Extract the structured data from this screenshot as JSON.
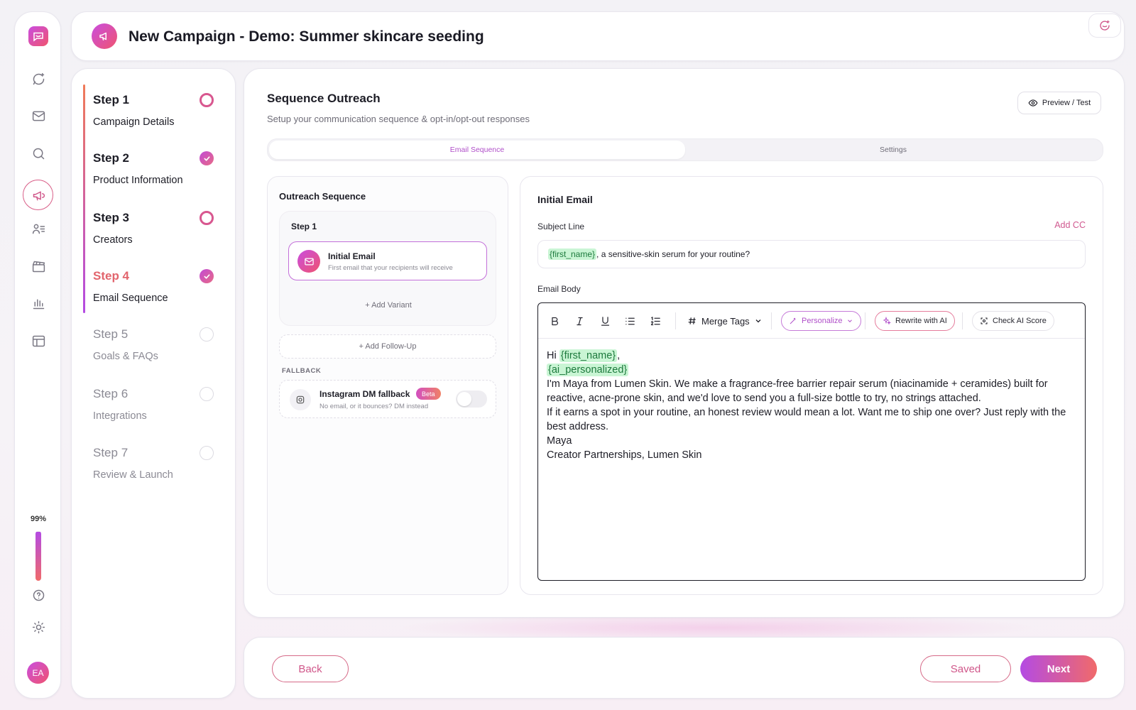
{
  "header": {
    "title": "New Campaign - Demo: Summer skincare seeding"
  },
  "sidebar": {
    "progress_label": "99%",
    "progress_value": 99,
    "avatar_initials": "EA",
    "icons": [
      "chat-sparkle-icon",
      "mail-icon",
      "search-icon",
      "megaphone-icon",
      "users-list-icon",
      "clapper-icon",
      "bar-chart-icon",
      "table-icon",
      "help-icon",
      "sun-icon"
    ]
  },
  "steps": [
    {
      "title": "Step 1",
      "subtitle": "Campaign Details",
      "status": "in-progress"
    },
    {
      "title": "Step 2",
      "subtitle": "Product Information",
      "status": "complete"
    },
    {
      "title": "Step 3",
      "subtitle": "Creators",
      "status": "in-progress"
    },
    {
      "title": "Step 4",
      "subtitle": "Email Sequence",
      "status": "complete-current"
    },
    {
      "title": "Step 5",
      "subtitle": "Goals & FAQs",
      "status": "pending"
    },
    {
      "title": "Step 6",
      "subtitle": "Integrations",
      "status": "pending"
    },
    {
      "title": "Step 7",
      "subtitle": "Review & Launch",
      "status": "pending"
    }
  ],
  "main": {
    "title": "Sequence Outreach",
    "subtitle": "Setup your communication sequence & opt-in/opt-out responses",
    "preview_label": "Preview / Test",
    "tabs": [
      {
        "label": "Email Sequence"
      },
      {
        "label": "Settings"
      }
    ]
  },
  "outreach": {
    "title": "Outreach Sequence",
    "step_label": "Step 1",
    "initial_title": "Initial Email",
    "initial_sub": "First email that your recipients will receive",
    "add_variant": "+ Add Variant",
    "add_followup": "+ Add Follow-Up",
    "fallback_heading": "FALLBACK",
    "fallback_title": "Instagram DM fallback",
    "fallback_badge": "Beta",
    "fallback_sub": "No email, or it bounces? DM instead"
  },
  "editor": {
    "title": "Initial Email",
    "subject_label": "Subject Line",
    "add_cc": "Add CC",
    "subject_tag": "{first_name}",
    "subject_rest": ", a sensitive-skin serum for your routine?",
    "body_label": "Email Body",
    "toolbar": {
      "merge_tags": "Merge Tags",
      "personalize": "Personalize",
      "rewrite": "Rewrite with AI",
      "check": "Check AI Score"
    },
    "body": {
      "hi": "Hi ",
      "tag1": "{first_name}",
      "comma": ",",
      "tag2": "{ai_personalized}",
      "p1": "I'm Maya from Lumen Skin. We make a fragrance-free barrier repair serum (niacinamide + ceramides) built for reactive, acne-prone skin, and we'd love to send you a full-size bottle to try, no strings attached.",
      "p2": "If it earns a spot in your routine, an honest review would mean a lot. Want me to ship one over? Just reply with the best address.",
      "p3": "Maya",
      "p4": "Creator Partnerships, Lumen Skin"
    }
  },
  "footer": {
    "back": "Back",
    "saved": "Saved",
    "next": "Next"
  }
}
